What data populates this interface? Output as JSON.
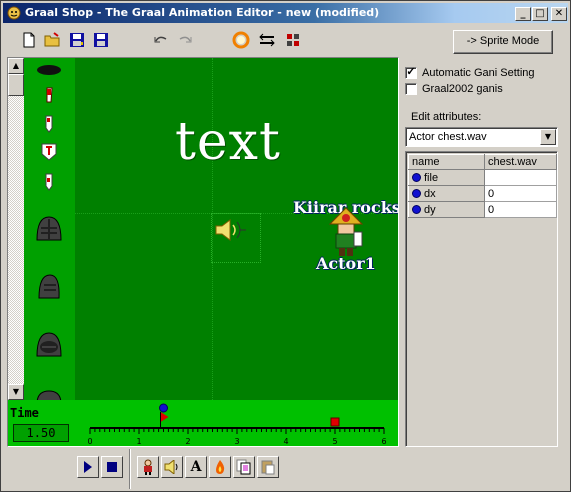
{
  "window": {
    "title": "Graal Shop - The Graal Animation Editor - new (modified)",
    "minimize_glyph": "_",
    "maximize_glyph": "□",
    "close_glyph": "✕"
  },
  "toolbar": {
    "buttons": [
      "new-file-icon",
      "open-folder-icon",
      "save-icon",
      "save-as-icon",
      "undo-icon",
      "redo-icon",
      "ring-icon",
      "flip-icon",
      "settings-icon"
    ],
    "sprite_mode_label": "-> Sprite Mode"
  },
  "canvas": {
    "big_text": "text",
    "actor_caption_top": "Kiirar rocks",
    "actor_caption_bottom": "Actor1"
  },
  "timeline": {
    "label": "Time",
    "value": "1.50",
    "ticks": [
      "0",
      "1",
      "2",
      "3",
      "4",
      "5",
      "6"
    ],
    "range": [
      0,
      6
    ],
    "current": 1.5,
    "marker_red": 5.0
  },
  "right_panel": {
    "auto_gani_label": "Automatic Gani Setting",
    "auto_gani_checked": true,
    "graal2002_label": "Graal2002 ganis",
    "graal2002_checked": false,
    "edit_attributes_label": "Edit attributes:",
    "attribute_selected": "Actor chest.wav",
    "grid": {
      "headers": [
        "name",
        "chest.wav"
      ],
      "rows": [
        {
          "name": "file",
          "value": ""
        },
        {
          "name": "dx",
          "value": "0"
        },
        {
          "name": "dy",
          "value": "0"
        }
      ]
    }
  },
  "bottom_bar": {
    "buttons": [
      "play-icon",
      "stop-icon",
      "character-icon",
      "sound-icon",
      "text-icon",
      "fire-icon",
      "copy-icon",
      "paste-icon"
    ],
    "text_button_label": "A"
  },
  "colors": {
    "canvas_bg": "#008000",
    "panel_bg": "#00a000",
    "timeline_bg": "#00c000",
    "face": "#d4d0c8"
  }
}
